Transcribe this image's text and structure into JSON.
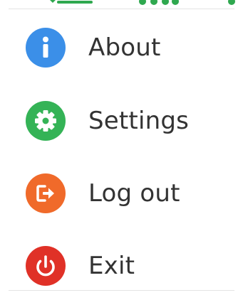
{
  "menu": {
    "items": [
      {
        "label": "About",
        "icon": "info-icon",
        "color": "#3b8fe8"
      },
      {
        "label": "Settings",
        "icon": "gear-icon",
        "color": "#34b356"
      },
      {
        "label": "Log out",
        "icon": "logout-icon",
        "color": "#f06a2a"
      },
      {
        "label": "Exit",
        "icon": "power-icon",
        "color": "#e03127"
      }
    ]
  },
  "colors": {
    "toolbar_green": "#2fa84f"
  }
}
